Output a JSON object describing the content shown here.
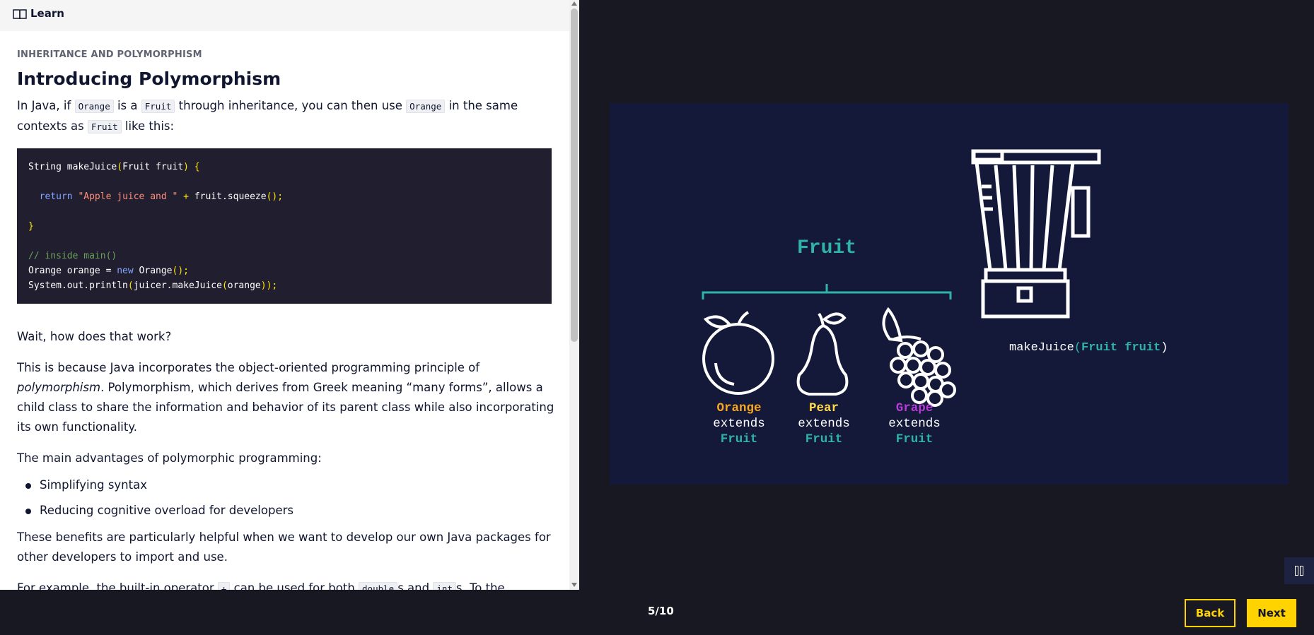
{
  "header": {
    "learn_label": "Learn",
    "icon": "book-icon"
  },
  "lesson": {
    "kicker": "INHERITANCE AND POLYMORPHISM",
    "title": "Introducing Polymorphism",
    "intro": {
      "t1": "In Java, if ",
      "c1": "Orange",
      "t2": " is a ",
      "c2": "Fruit",
      "t3": " through inheritance, you can then use ",
      "c3": "Orange",
      "t4": " in the same contexts as ",
      "c4": "Fruit",
      "t5": " like this:"
    },
    "code": {
      "l1a": "String makeJuice",
      "l1b": "(",
      "l1c": "Fruit fruit",
      "l1d": ")",
      "l1e": " {",
      "l2a": "  ",
      "l2b": "return",
      "l2c": " ",
      "l2d": "\"Apple juice and \"",
      "l2e": " + ",
      "l2f": "fruit.squeeze",
      "l2g": "();",
      "l3": "}",
      "l4": "// inside main()",
      "l5a": "Orange orange = ",
      "l5b": "new",
      "l5c": " Orange",
      "l5d": "();",
      "l6a": "System.out.println",
      "l6b": "(",
      "l6c": "juicer.makeJuice",
      "l6d": "(",
      "l6e": "orange",
      "l6f": "));"
    },
    "wait": "Wait, how does that work?",
    "because": {
      "t1": "This is because Java incorporates the object-oriented programming principle of ",
      "em": "polymorphism",
      "t2": ". Polymorphism, which derives from Greek meaning “many forms”, allows a child class to share the information and behavior of its parent class while also incorporating its own functionality."
    },
    "advantages_intro": "The main advantages of polymorphic programming:",
    "advantages": [
      "Simplifying syntax",
      "Reducing cognitive overload for developers"
    ],
    "benefits": "These benefits are particularly helpful when we want to develop our own Java packages for other developers to import and use.",
    "example": {
      "t1": "For example, the built-in operator ",
      "c1": "+",
      "t2": " can be used for both ",
      "c2": "double",
      "t3": "s and ",
      "c3": "int",
      "t4": "s. To the computer,"
    }
  },
  "slide": {
    "parent": "Fruit",
    "children": [
      {
        "name": "Orange",
        "extends": "extends",
        "parent": "Fruit",
        "name_color": "#f5a623",
        "icon": "orange-icon"
      },
      {
        "name": "Pear",
        "extends": "extends",
        "parent": "Fruit",
        "name_color": "#ffd84d",
        "icon": "pear-icon"
      },
      {
        "name": "Grape",
        "extends": "extends",
        "parent": "Fruit",
        "name_color": "#b83bd6",
        "icon": "grape-icon"
      }
    ],
    "method": {
      "name": "makeJuice",
      "open": "(",
      "param": "Fruit fruit",
      "close": ")"
    },
    "accent": "#2fb3a8",
    "blender_icon": "blender-icon"
  },
  "footer": {
    "counter": "5/10",
    "back_label": "Back",
    "next_label": "Next",
    "pause_icon": "pause-icon"
  }
}
